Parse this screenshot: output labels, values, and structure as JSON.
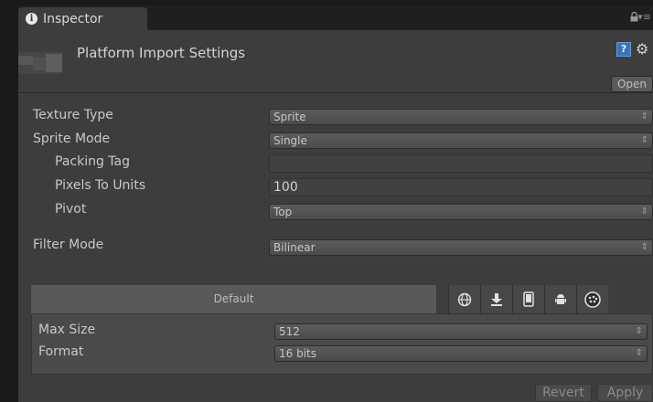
{
  "tab": {
    "label": "Inspector",
    "info_glyph": "i"
  },
  "header": {
    "title": "Platform Import Settings",
    "help_glyph": "?",
    "open_label": "Open"
  },
  "properties": {
    "texture_type": {
      "label": "Texture Type",
      "value": "Sprite"
    },
    "sprite_mode": {
      "label": "Sprite Mode",
      "value": "Single"
    },
    "packing_tag": {
      "label": "Packing Tag",
      "value": ""
    },
    "pixels_to_units": {
      "label": "Pixels To Units",
      "value": "100"
    },
    "pivot": {
      "label": "Pivot",
      "value": "Top"
    },
    "filter_mode": {
      "label": "Filter Mode",
      "value": "Bilinear"
    }
  },
  "platforms": {
    "default_label": "Default",
    "icons": [
      "globe-icon",
      "download-icon",
      "mobile-icon",
      "android-icon",
      "blackberry-icon"
    ]
  },
  "platform_settings": {
    "max_size": {
      "label": "Max Size",
      "value": "512"
    },
    "format": {
      "label": "Format",
      "value": "16 bits"
    }
  },
  "buttons": {
    "revert": "Revert",
    "apply": "Apply"
  },
  "colors": {
    "panel_bg": "#3d3d3d",
    "tab_bar_bg": "#1f1f1f",
    "accent_help": "#3a73b3"
  }
}
